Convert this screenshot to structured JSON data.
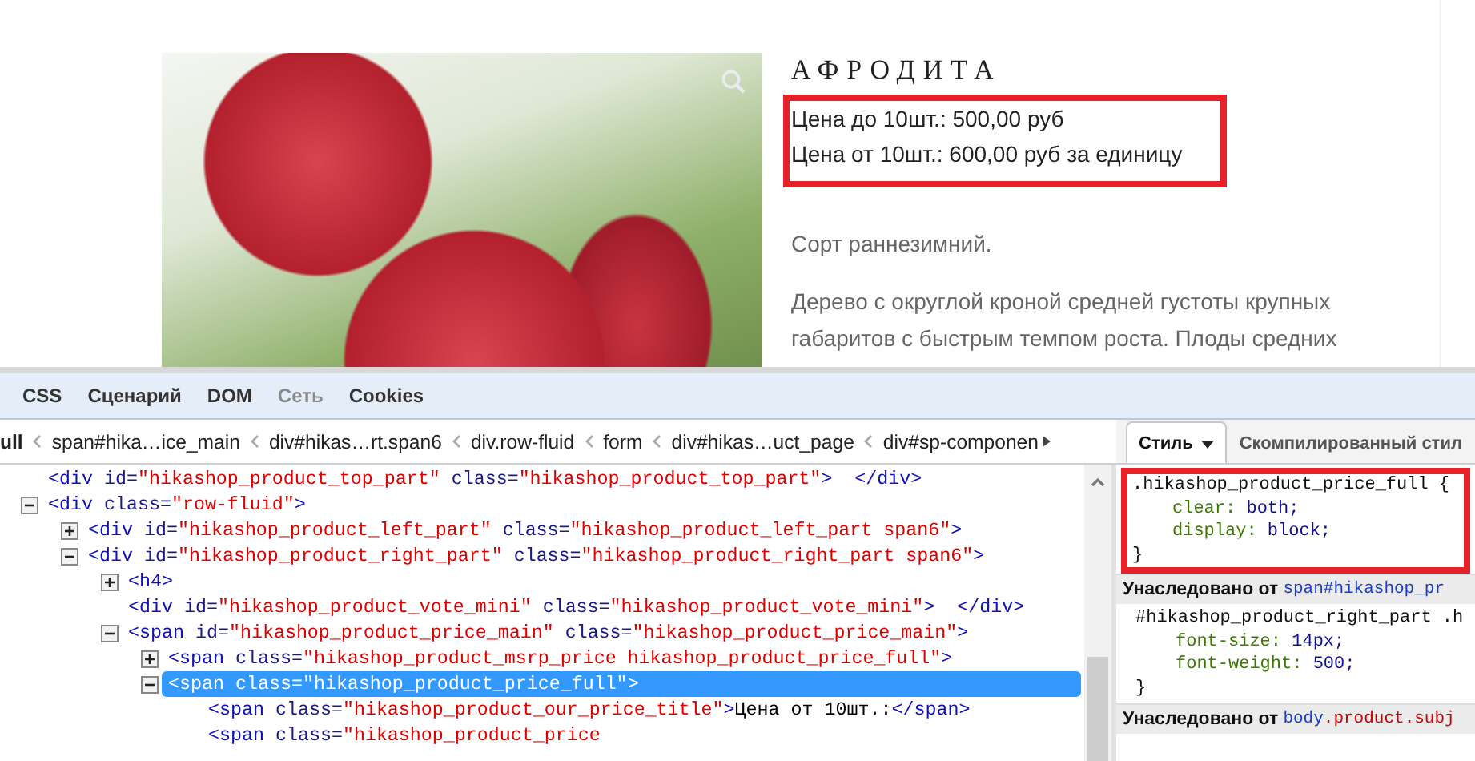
{
  "page": {
    "title": "АФРОДИТА",
    "price_box": {
      "highlighted": true,
      "lines": [
        "Цена до 10шт.: 500,00 руб",
        "Цена от 10шт.: 600,00 руб за единицу"
      ]
    },
    "paragraphs": [
      "Сорт раннезимний.",
      "Дерево с округлой кроной средней густоты крупных габаритов с быстрым темпом роста. Плоды средних"
    ]
  },
  "devtools": {
    "tabs": [
      {
        "label": "CSS",
        "disabled": false
      },
      {
        "label": "Сценарий",
        "disabled": false
      },
      {
        "label": "DOM",
        "disabled": false
      },
      {
        "label": "Сеть",
        "disabled": true
      },
      {
        "label": "Cookies",
        "disabled": false
      }
    ],
    "breadcrumbs": [
      {
        "label": "ull",
        "current": true
      },
      {
        "label": "span#hika…ice_main",
        "current": false
      },
      {
        "label": "div#hikas…rt.span6",
        "current": false
      },
      {
        "label": "div.row-fluid",
        "current": false
      },
      {
        "label": "form",
        "current": false
      },
      {
        "label": "div#hikas…uct_page",
        "current": false
      },
      {
        "label": "div#sp-componen",
        "current": false
      }
    ],
    "html_tree": [
      {
        "selected": false,
        "lines": [
          [
            {
              "kind": "tag",
              "text": "<div"
            },
            {
              "kind": "attr",
              "text": " id="
            },
            {
              "kind": "value",
              "text": "\"hikashop_product_top_part\""
            },
            {
              "kind": "attr",
              "text": " class="
            },
            {
              "kind": "value",
              "text": "\"hikashop_product_top_part\""
            },
            {
              "kind": "tag",
              "text": ">  </div>"
            }
          ]
        ]
      },
      {
        "selected": false,
        "expanded": true,
        "lines": [
          [
            {
              "kind": "tag",
              "text": "<div"
            },
            {
              "kind": "attr",
              "text": " class="
            },
            {
              "kind": "value",
              "text": "\"row-fluid\""
            },
            {
              "kind": "tag",
              "text": ">"
            }
          ]
        ],
        "children": [
          {
            "selected": false,
            "expanded": false,
            "lines": [
              [
                {
                  "kind": "tag",
                  "text": "<div"
                },
                {
                  "kind": "attr",
                  "text": " id="
                },
                {
                  "kind": "value",
                  "text": "\"hikashop_product_left_part\""
                },
                {
                  "kind": "attr",
                  "text": " class="
                },
                {
                  "kind": "value",
                  "text": "\"hikashop_product_left_part span6\""
                },
                {
                  "kind": "tag",
                  "text": ">"
                }
              ]
            ]
          },
          {
            "selected": false,
            "expanded": true,
            "lines": [
              [
                {
                  "kind": "tag",
                  "text": "<div"
                },
                {
                  "kind": "attr",
                  "text": " id="
                },
                {
                  "kind": "value",
                  "text": "\"hikashop_product_right_part\""
                },
                {
                  "kind": "attr",
                  "text": " class="
                },
                {
                  "kind": "value",
                  "text": "\"hikashop_product_right_part span6\""
                },
                {
                  "kind": "tag",
                  "text": ">"
                }
              ]
            ],
            "children": [
              {
                "selected": false,
                "expanded": false,
                "lines": [
                  [
                    {
                      "kind": "tag",
                      "text": "<h4>"
                    }
                  ]
                ]
              },
              {
                "selected": false,
                "lines": [
                  [
                    {
                      "kind": "tag",
                      "text": "<div"
                    },
                    {
                      "kind": "attr",
                      "text": " id="
                    },
                    {
                      "kind": "value",
                      "text": "\"hikashop_product_vote_mini\""
                    },
                    {
                      "kind": "attr",
                      "text": " class="
                    },
                    {
                      "kind": "value",
                      "text": "\"hikashop_product_vote_mini\""
                    },
                    {
                      "kind": "tag",
                      "text": ">  </div>"
                    }
                  ]
                ]
              },
              {
                "selected": false,
                "expanded": true,
                "lines": [
                  [
                    {
                      "kind": "tag",
                      "text": "<span"
                    },
                    {
                      "kind": "attr",
                      "text": " id="
                    },
                    {
                      "kind": "value",
                      "text": "\"hikashop_product_price_main\""
                    },
                    {
                      "kind": "attr",
                      "text": " class="
                    },
                    {
                      "kind": "value",
                      "text": "\"hikashop_product_price_main\""
                    },
                    {
                      "kind": "tag",
                      "text": ">"
                    }
                  ]
                ],
                "children": [
                  {
                    "selected": false,
                    "expanded": false,
                    "lines": [
                      [
                        {
                          "kind": "tag",
                          "text": "<span"
                        },
                        {
                          "kind": "attr",
                          "text": " class="
                        },
                        {
                          "kind": "value",
                          "text": "\"hikashop_product_msrp_price hikashop_product_price_full\""
                        },
                        {
                          "kind": "tag",
                          "text": ">"
                        }
                      ]
                    ]
                  },
                  {
                    "selected": true,
                    "expanded": true,
                    "lines": [
                      [
                        {
                          "kind": "tag",
                          "text": "<span"
                        },
                        {
                          "kind": "attr",
                          "text": " class="
                        },
                        {
                          "kind": "value",
                          "text": "\"hikashop_product_price_full\""
                        },
                        {
                          "kind": "tag",
                          "text": ">"
                        }
                      ]
                    ],
                    "children": [
                      {
                        "selected": false,
                        "lines": [
                          [
                            {
                              "kind": "tag",
                              "text": "<span"
                            },
                            {
                              "kind": "attr",
                              "text": " class="
                            },
                            {
                              "kind": "value",
                              "text": "\"hikashop_product_our_price_title\""
                            },
                            {
                              "kind": "tag",
                              "text": ">"
                            },
                            {
                              "kind": "text",
                              "text": "Цена от 10шт.:"
                            },
                            {
                              "kind": "tag",
                              "text": "</span>"
                            }
                          ]
                        ]
                      },
                      {
                        "selected": false,
                        "lines": [
                          [
                            {
                              "kind": "tag",
                              "text": "<span"
                            },
                            {
                              "kind": "attr",
                              "text": " class="
                            },
                            {
                              "kind": "value",
                              "text": "\"hikashop_product_price"
                            }
                          ]
                        ]
                      }
                    ]
                  }
                ]
              }
            ]
          }
        ]
      }
    ],
    "side_tabs": [
      {
        "label": "Стиль",
        "selected": true,
        "has_menu": true
      },
      {
        "label": "Скомпилированный стил",
        "selected": false,
        "has_menu": false
      }
    ],
    "style_sections": [
      {
        "kind": "rule",
        "highlighted": true,
        "selector": ".hikashop_product_price_full {",
        "declarations": [
          {
            "property": "clear:",
            "value": "both;"
          },
          {
            "property": "display:",
            "value": "block;"
          }
        ],
        "close": "}"
      },
      {
        "kind": "inherited",
        "label": "Унаследовано от",
        "source": [
          {
            "kind": "tag",
            "text": "span#hikashop_pr"
          }
        ]
      },
      {
        "kind": "rule",
        "highlighted": false,
        "selector": "#hikashop_product_right_part .h",
        "declarations": [
          {
            "property": "font-size:",
            "value": "14px;"
          },
          {
            "property": "font-weight:",
            "value": "500;"
          }
        ],
        "close": "}"
      },
      {
        "kind": "inherited",
        "label": "Унаследовано от",
        "source": [
          {
            "kind": "tag",
            "text": "body"
          },
          {
            "kind": "class",
            "text": ".product.subj"
          }
        ]
      }
    ]
  }
}
